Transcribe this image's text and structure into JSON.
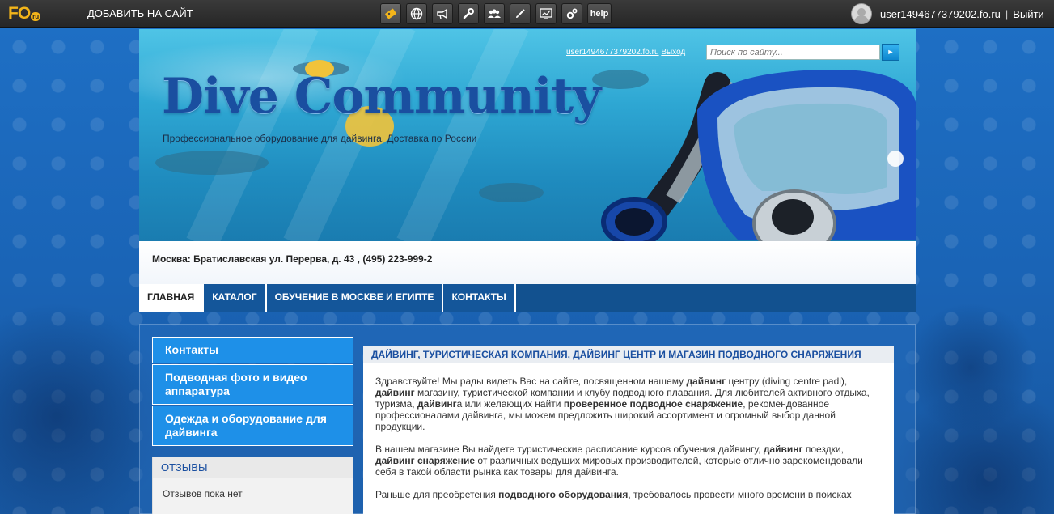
{
  "topbar": {
    "logo_text": "FO",
    "logo_ru": "ru",
    "add_site": "ДОБАВИТЬ НА САЙТ",
    "help": "help",
    "user": "user1494677379202.fo.ru",
    "separator": "|",
    "logout": "Выйти",
    "tool_icons": [
      "coupon-icon",
      "globe-icon",
      "megaphone-icon",
      "wrench-icon",
      "users-icon",
      "brush-icon",
      "chart-icon",
      "gears-icon"
    ]
  },
  "header": {
    "title": "Dive Community",
    "tagline": "Профессиональное оборудование для дайвинга. Доставка по России",
    "user_link": "user1494677379202.fo.ru",
    "exit_link": "Выход",
    "search_placeholder": "Поиск по сайту...",
    "search_button": "►",
    "address": "Москва: Братиславская ул. Перерва, д. 43 , (495) 223-999-2"
  },
  "nav": {
    "items": [
      {
        "label": "ГЛАВНАЯ"
      },
      {
        "label": "КАТАЛОГ"
      },
      {
        "label": "ОБУЧЕНИЕ В МОСКВЕ И ЕГИПТЕ"
      },
      {
        "label": "КОНТАКТЫ"
      }
    ]
  },
  "sidebar": {
    "items": [
      {
        "label": "Контакты"
      },
      {
        "label": "Подводная фото и видео аппаратура"
      },
      {
        "label": "Одежда и оборудование для дайвинга"
      }
    ],
    "reviews_title": "ОТЗЫВЫ",
    "reviews_text": "Отзывов пока нет"
  },
  "main": {
    "title": "ДАЙВИНГ, ТУРИСТИЧЕСКАЯ КОМПАНИЯ, ДАЙВИНГ ЦЕНТР И МАГАЗИН ПОДВОДНОГО СНАРЯЖЕНИЯ",
    "p1": {
      "a": "Здравствуйте! Мы рады видеть Вас на сайте, посвященном нашему ",
      "b": "дайвинг",
      "c": " центру (diving centre padi), ",
      "d": "дайвинг",
      "e": " магазину, туристической компании и клубу подводного плавания. Для любителей активного отдыха, туризма, ",
      "f": "дайвинг",
      "g": "а или желающих найти ",
      "h": "проверенное подводное снаряжение",
      "i": ", рекомендованное профессионалами дайвинга, мы можем предложить широкий ассортимент и огромный выбор данной продукции."
    },
    "p2": {
      "a": "В нашем магазине Вы найдете туристические расписание курсов обучения дайвингу, ",
      "b": "дайвинг",
      "c": " поездки, ",
      "d": "дайвинг снаряжение",
      "e": " от различных ведущих мировых производителей, которые отлично зарекомендовали себя в такой области рынка как товары для дайвинга."
    },
    "p3": {
      "a": "Раньше для преобретения ",
      "b": "подводного оборудования",
      "c": ", требовалось провести много времени в поисках"
    }
  },
  "colors": {
    "accent": "#1e90e8",
    "nav": "#12518f",
    "title_blue": "#1a4fa0",
    "topbar": "#2b2b2b",
    "logo_yellow": "#f3b51a"
  }
}
